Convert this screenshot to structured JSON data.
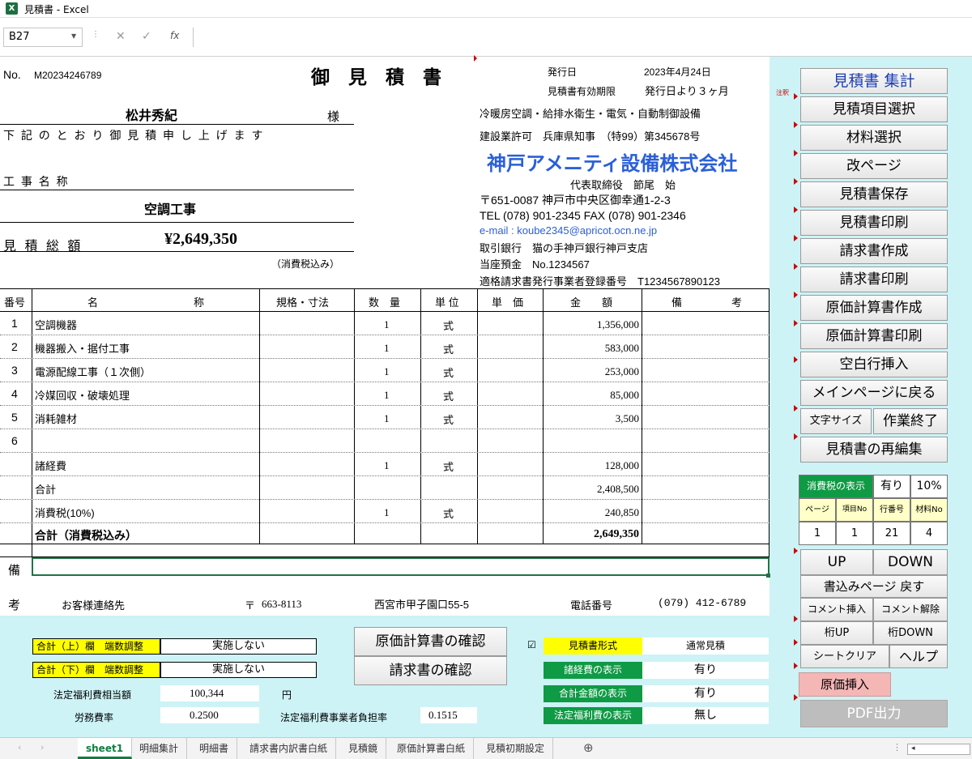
{
  "window": {
    "title": "見積書 - Excel",
    "icon": "excel-icon"
  },
  "formula_bar": {
    "name_box": "B27",
    "fx": "fx",
    "cancel": "✕",
    "enter": "✓",
    "value": ""
  },
  "header": {
    "no_label": "No.",
    "no_value": "M20234246789",
    "title": "御　見　積　書",
    "issue_label": "発行日",
    "issue_value": "2023年4月24日",
    "valid_label": "見積書有効期限",
    "valid_value": "発行日より３ヶ月",
    "customer": "松井秀紀",
    "honorific": "様",
    "intro": "下 記 の と お り 御 見 積 申 し 上 げ ま す",
    "project_label": "工 事 名 称",
    "project_value": "空調工事",
    "total_label": "見 積 総 額",
    "total_value": "¥2,649,350",
    "tax_note": "（消費税込み）"
  },
  "company": {
    "business": "冷暖房空調・給排水衛生・電気・自動制御設備",
    "license": "建設業許可　兵庫県知事　（特99）第345678号",
    "name": "神戸アメニティ設備株式会社",
    "rep": "代表取締役　節尾　始",
    "address": "〒651-0087 神戸市中央区御幸通1-2-3",
    "tel": "TEL (078) 901-2345  FAX (078) 901-2346",
    "email": "e-mail : koube2345@apricot.ocn.ne.jp",
    "bank": "取引銀行　猫の手神戸銀行神戸支店",
    "account": "当座預金　No.1234567",
    "invoice_reg": "適格請求書発行事業者登録番号　T1234567890123"
  },
  "table": {
    "headers": {
      "no": "番号",
      "name1": "名",
      "name2": "称",
      "spec": "規格・寸法",
      "qty": "数　量",
      "unit": "単 位",
      "price": "単　価",
      "amount": "金　　額",
      "note1": "備",
      "note2": "考"
    },
    "rows": [
      {
        "no": "1",
        "name": "空調機器",
        "qty": "1",
        "unit": "式",
        "amount": "1,356,000"
      },
      {
        "no": "2",
        "name": "機器搬入・据付工事",
        "qty": "1",
        "unit": "式",
        "amount": "583,000"
      },
      {
        "no": "3",
        "name": "電源配線工事（１次側）",
        "qty": "1",
        "unit": "式",
        "amount": "253,000"
      },
      {
        "no": "4",
        "name": "冷媒回収・破壊処理",
        "qty": "1",
        "unit": "式",
        "amount": "85,000"
      },
      {
        "no": "5",
        "name": "消耗雑材",
        "qty": "1",
        "unit": "式",
        "amount": "3,500"
      },
      {
        "no": "6",
        "name": "",
        "qty": "",
        "unit": "",
        "amount": ""
      },
      {
        "no": "",
        "name": "諸経費",
        "qty": "1",
        "unit": "式",
        "amount": "128,000"
      },
      {
        "no": "",
        "name": "合計",
        "qty": "",
        "unit": "",
        "amount": "2,408,500"
      },
      {
        "no": "",
        "name": "消費税(10%)",
        "qty": "1",
        "unit": "式",
        "amount": "240,850"
      },
      {
        "no": "",
        "name": "合計（消費税込み）",
        "qty": "",
        "unit": "",
        "amount": "2,649,350"
      }
    ]
  },
  "remarks": {
    "label1": "備",
    "label2": "考",
    "contact_label": "お客様連絡先",
    "postal_mark": "〒",
    "postal": "663-8113",
    "address": "西宮市甲子園口55-5",
    "phone_label": "電話番号",
    "phone": "(079) 412-6789"
  },
  "right_buttons": [
    "見積書 集計",
    "見積項目選択",
    "材料選択",
    "改ページ",
    "見積書保存",
    "見積書印刷",
    "請求書作成",
    "請求書印刷",
    "原価計算書作成",
    "原価計算書印刷",
    "空白行挿入",
    "メインページに戻る"
  ],
  "note_small": "注釈",
  "font_size_btn": "文字サイズ",
  "quit_btn": "作業終了",
  "reedit_btn": "見積書の再編集",
  "info": {
    "tax_label": "消費税の表示",
    "tax_on": "有り",
    "tax_rate": "10%",
    "h_page": "ページ",
    "h_item": "項目No",
    "h_row": "行番号",
    "h_mat": "材料No",
    "v_page": "1",
    "v_item": "1",
    "v_row": "21",
    "v_mat": "4"
  },
  "nav": {
    "up": "UP",
    "down": "DOWN",
    "return": "書込みページ 戻す",
    "comment_ins": "コメント挿入",
    "comment_del": "コメント解除",
    "digit_up": "桁UP",
    "digit_down": "桁DOWN",
    "clear": "シートクリア",
    "help": "ヘルプ",
    "cost_ins": "原価挿入",
    "pdf": "PDF出力"
  },
  "bottom": {
    "upper_label": "合計（上）欄　端数調整",
    "upper_value": "実施しない",
    "lower_label": "合計（下）欄　端数調整",
    "lower_value": "実施しない",
    "welfare_label": "法定福利費相当額",
    "welfare_value": "100,344",
    "welfare_unit": "円",
    "labor_label": "労務費率",
    "labor_value": "0.2500",
    "burden_label": "法定福利費事業者負担率",
    "burden_value": "0.1515",
    "check_cost": "原価計算書の確認",
    "check_invoice": "請求書の確認",
    "checkbox": "☑",
    "format_label": "見積書形式",
    "format_value": "通常見積",
    "expense_label": "諸経費の表示",
    "expense_value": "有り",
    "sum_label": "合計金額の表示",
    "sum_value": "有り",
    "welfare_disp_label": "法定福利費の表示",
    "welfare_disp_value": "無し"
  },
  "tabs": [
    "sheet1",
    "明細集計",
    "明細書",
    "請求書内訳書白紙",
    "見積鏡",
    "原価計算書白紙",
    "見積初期設定"
  ],
  "tab_add": "⊕",
  "colors": {
    "sheet_bg": "#cdf3f6",
    "accent_green": "#0f9a45",
    "yellow": "#ffff00",
    "company_blue": "#2a5fd8",
    "pink": "#f5b6b6"
  }
}
